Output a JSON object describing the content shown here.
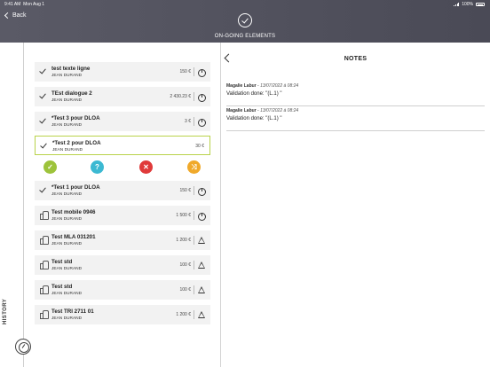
{
  "status_bar": {
    "time": "9:41 AM",
    "date": "Mon Aug 1",
    "battery": "100%"
  },
  "header": {
    "back_label": "Back",
    "title": "ON-GOING ELEMENTS"
  },
  "rail": {
    "history_label": "HISTORY"
  },
  "items": [
    {
      "title": "test texte ligne",
      "person": "JEAN DURAND",
      "amount": "150 €",
      "lead_icon": "check-icon",
      "status_icon": "timer-icon",
      "selected": false
    },
    {
      "title": "TEst dialogue 2",
      "person": "JEAN DURAND",
      "amount": "2 430.23 €",
      "lead_icon": "check-icon",
      "status_icon": "timer-icon",
      "selected": false
    },
    {
      "title": "*Test 3 pour DLOA",
      "person": "JEAN DURAND",
      "amount": "3 €",
      "lead_icon": "check-icon",
      "status_icon": "timer-icon",
      "selected": false
    },
    {
      "title": "*Test 2 pour DLOA",
      "person": "JEAN DURAND",
      "amount": "30 €",
      "lead_icon": "check-icon",
      "status_icon": "none",
      "selected": true
    },
    {
      "title": "*Test 1 pour DLOA",
      "person": "JEAN DURAND",
      "amount": "150 €",
      "lead_icon": "check-icon",
      "status_icon": "timer-icon",
      "selected": false
    },
    {
      "title": "Test mobile 0946",
      "person": "JEAN DURAND",
      "amount": "1 500 €",
      "lead_icon": "thumb-icon",
      "status_icon": "timer-icon",
      "selected": false
    },
    {
      "title": "Test MLA 031201",
      "person": "JEAN DURAND",
      "amount": "1 200 €",
      "lead_icon": "thumb-icon",
      "status_icon": "warning-icon",
      "selected": false
    },
    {
      "title": "Test std",
      "person": "JEAN DURAND",
      "amount": "100 €",
      "lead_icon": "thumb-icon",
      "status_icon": "warning-icon",
      "selected": false
    },
    {
      "title": "Test std",
      "person": "JEAN DURAND",
      "amount": "100 €",
      "lead_icon": "thumb-icon",
      "status_icon": "warning-icon",
      "selected": false
    },
    {
      "title": "Test TRI 2711 01",
      "person": "JEAN DURAND",
      "amount": "1 200 €",
      "lead_icon": "thumb-icon",
      "status_icon": "warning-icon",
      "selected": false
    }
  ],
  "actions": {
    "validate": {
      "glyph": "✓",
      "color": "#9dc33b"
    },
    "question": {
      "glyph": "?",
      "color": "#3cb9d2"
    },
    "refuse": {
      "glyph": "✕",
      "color": "#e03a3a"
    },
    "transfer": {
      "glyph": "⤨",
      "color": "#f0a92a"
    }
  },
  "notes": {
    "title": "NOTES",
    "entries": [
      {
        "author": "Magalie Labur",
        "date": "13/07/2022 à 08:24",
        "text": "Validation done: \"(L.1) \""
      },
      {
        "author": "Magalie Labur",
        "date": "13/07/2022 à 08:24",
        "text": "Validation done: \"(L.1) \""
      }
    ]
  }
}
